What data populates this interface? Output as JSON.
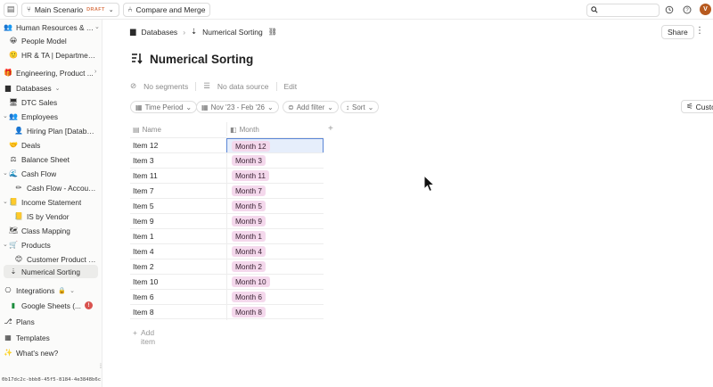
{
  "topbar": {
    "scenario_label": "Main Scenario",
    "draft_badge": "DRAFT",
    "compare_label": "Compare and Merge",
    "search_placeholder": "",
    "avatar_initial": "V"
  },
  "sidebar": {
    "items": [
      {
        "label": "Human Resources & T...",
        "icon": "people-icon"
      },
      {
        "label": "People Model",
        "icon": "emoji-icon"
      },
      {
        "label": "HR & TA | Departmen...",
        "icon": "emoji-icon"
      },
      {
        "label": "Engineering, Product ...",
        "icon": "gear-emoji-icon"
      },
      {
        "label": "Databases",
        "icon": "database-icon"
      },
      {
        "label": "DTC Sales",
        "icon": "monitor-icon"
      },
      {
        "label": "Employees",
        "icon": "group-icon"
      },
      {
        "label": "Hiring Plan [Database]",
        "icon": "person-icon"
      },
      {
        "label": "Deals",
        "icon": "handshake-icon"
      },
      {
        "label": "Balance Sheet",
        "icon": "scale-icon"
      },
      {
        "label": "Cash Flow",
        "icon": "wave-icon"
      },
      {
        "label": "Cash Flow - Accoun...",
        "icon": "pencil-icon"
      },
      {
        "label": "Income Statement",
        "icon": "ledger-icon"
      },
      {
        "label": "IS by Vendor",
        "icon": "ledger-icon"
      },
      {
        "label": "Class Mapping",
        "icon": "map-icon"
      },
      {
        "label": "Products",
        "icon": "cart-icon"
      },
      {
        "label": "Customer Product U...",
        "icon": "emoji-icon"
      },
      {
        "label": "Numerical Sorting",
        "icon": "sort-icon"
      },
      {
        "label": "Integrations",
        "icon": "plug-icon"
      },
      {
        "label": "Google Sheets (...",
        "icon": "sheets-icon"
      },
      {
        "label": "Plans",
        "icon": "plans-icon"
      },
      {
        "label": "Templates",
        "icon": "templates-icon"
      },
      {
        "label": "What's new?",
        "icon": "sparkle-icon"
      }
    ],
    "alert_badge": "!",
    "footer_id": "0b17dc2c-bbb8-45f5-8184-4e3848b6c"
  },
  "main": {
    "breadcrumb_root": "Databases",
    "breadcrumb_page": "Numerical Sorting",
    "share_label": "Share",
    "title": "Numerical Sorting",
    "meta": {
      "segments": "No segments",
      "data_source": "No data source",
      "edit": "Edit"
    },
    "filters": {
      "time_period": "Time Period",
      "range": "Nov '23 - Feb '26",
      "add_filter": "Add filter",
      "sort": "Sort",
      "customize": "Customize"
    },
    "table": {
      "col_name": "Name",
      "col_month": "Month",
      "rows": [
        {
          "name": "Item 12",
          "month": "Month 12"
        },
        {
          "name": "Item 3",
          "month": "Month 3"
        },
        {
          "name": "Item 11",
          "month": "Month 11"
        },
        {
          "name": "Item 7",
          "month": "Month 7"
        },
        {
          "name": "Item 5",
          "month": "Month 5"
        },
        {
          "name": "Item 9",
          "month": "Month 9"
        },
        {
          "name": "Item 1",
          "month": "Month 1"
        },
        {
          "name": "Item 4",
          "month": "Month 4"
        },
        {
          "name": "Item 2",
          "month": "Month 2"
        },
        {
          "name": "Item 10",
          "month": "Month 10"
        },
        {
          "name": "Item 6",
          "month": "Month 6"
        },
        {
          "name": "Item 8",
          "month": "Month 8"
        }
      ],
      "add_item": "Add item"
    }
  },
  "colors": {
    "pill_bg": "#f4d8ec",
    "selection_border": "#5b86d6",
    "draft": "#d97a50",
    "avatar": "#b75a1f"
  }
}
